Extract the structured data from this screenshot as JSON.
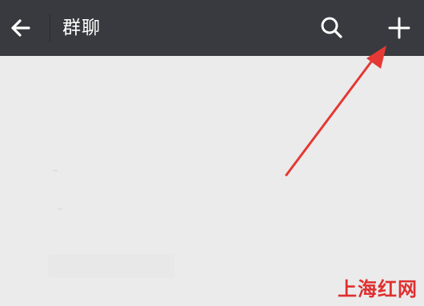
{
  "toolbar": {
    "title": "群聊",
    "back_icon": "arrow-left-icon",
    "search_icon": "search-icon",
    "add_icon": "plus-icon",
    "background_color": "#393a3f"
  },
  "annotation": {
    "color": "#e53935",
    "points_to": "add-button"
  },
  "watermark": {
    "text": "上海红网",
    "color": "#e02020"
  }
}
